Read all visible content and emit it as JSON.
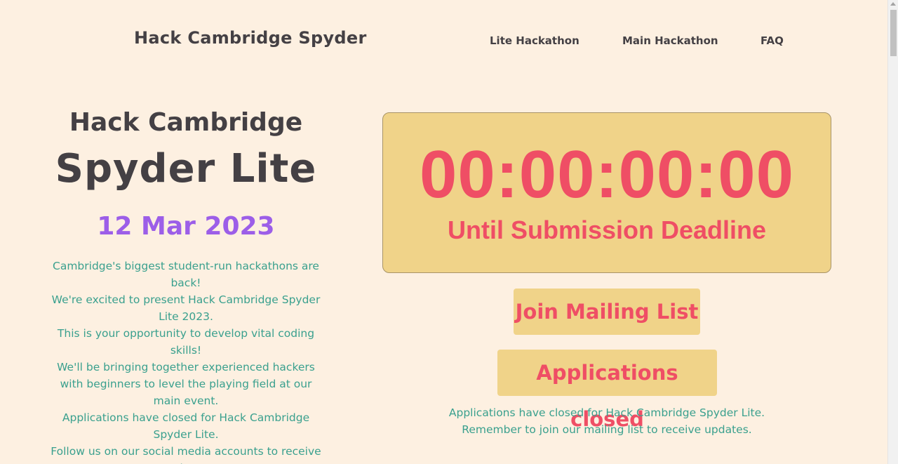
{
  "header": {
    "site_title": "Hack Cambridge Spyder",
    "nav": [
      {
        "label": "Lite Hackathon"
      },
      {
        "label": "Main Hackathon"
      },
      {
        "label": "FAQ"
      }
    ]
  },
  "hero": {
    "line1": "Hack Cambridge",
    "line2": "Spyder Lite",
    "date": "12 Mar 2023",
    "paragraphs": [
      "Cambridge's biggest student-run hackathons are back!",
      "We're excited to present Hack Cambridge Spyder Lite 2023.",
      "This is your opportunity to develop vital coding skills!",
      "We'll be bringing together experienced hackers with beginners to level the playing field at our main event.",
      "Applications have closed for Hack Cambridge Spyder Lite.",
      "Follow us on our social media accounts to receive updates."
    ]
  },
  "countdown": {
    "time": "00:00:00:00",
    "caption": "Until Submission Deadline"
  },
  "actions": {
    "mailing_list_label": "Join Mailing List",
    "applications_label": "Applications closed"
  },
  "applications_note": {
    "lines": [
      "Applications have closed for Hack Cambridge Spyder Lite.",
      "Remember to join our mailing list to receive updates."
    ]
  },
  "colors": {
    "background": "#fdf0e1",
    "heading": "#444044",
    "date_purple": "#9c5ee8",
    "body_teal": "#3aa08e",
    "accent_red": "#ef4e65",
    "panel_yellow": "#f0d389"
  }
}
